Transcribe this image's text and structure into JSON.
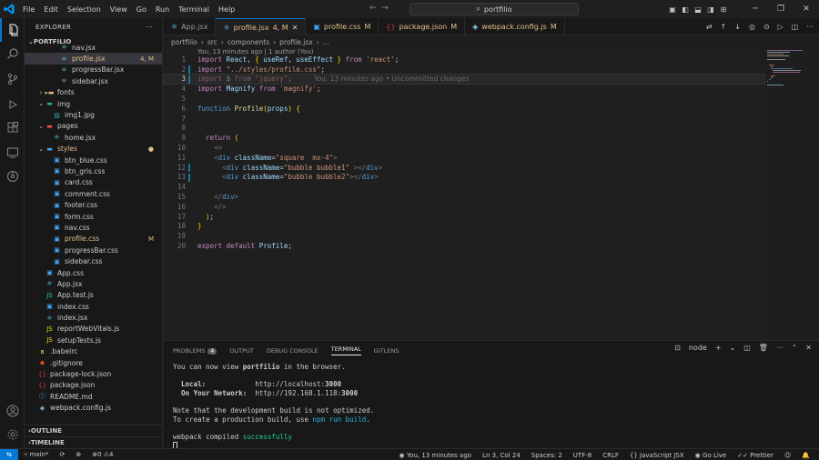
{
  "menu": [
    "File",
    "Edit",
    "Selection",
    "View",
    "Go",
    "Run",
    "Terminal",
    "Help"
  ],
  "command_center": "portfilio",
  "explorer": {
    "title": "EXPLORER",
    "root": "PORTFILIO",
    "rows": [
      {
        "name": "nav.jsx",
        "icon": "react",
        "depth": 3,
        "folder": false,
        "open": false,
        "badge": "",
        "sel": false
      },
      {
        "name": "profile.jsx",
        "icon": "react",
        "depth": 3,
        "folder": false,
        "open": false,
        "badge": "4, M",
        "sel": true
      },
      {
        "name": "progressBar.jsx",
        "icon": "react",
        "depth": 3,
        "folder": false,
        "open": false,
        "badge": "",
        "sel": false
      },
      {
        "name": "sidebar.jsx",
        "icon": "react",
        "depth": 3,
        "folder": false,
        "open": false,
        "badge": "",
        "sel": false
      },
      {
        "name": "fonts",
        "icon": "folder",
        "depth": 1,
        "folder": true,
        "open": false,
        "badge": "",
        "sel": false
      },
      {
        "name": "img",
        "icon": "folder-img",
        "depth": 1,
        "folder": true,
        "open": true,
        "badge": "",
        "sel": false
      },
      {
        "name": "img1.jpg",
        "icon": "image",
        "depth": 2,
        "folder": false,
        "open": false,
        "badge": "",
        "sel": false
      },
      {
        "name": "pages",
        "icon": "folder-pages",
        "depth": 1,
        "folder": true,
        "open": true,
        "badge": "",
        "sel": false
      },
      {
        "name": "home.jsx",
        "icon": "react",
        "depth": 2,
        "folder": false,
        "open": false,
        "badge": "",
        "sel": false
      },
      {
        "name": "styles",
        "icon": "folder-styles",
        "depth": 1,
        "folder": true,
        "open": true,
        "badge": "●",
        "sel": false
      },
      {
        "name": "btn_blue.css",
        "icon": "css",
        "depth": 2,
        "folder": false,
        "open": false,
        "badge": "",
        "sel": false
      },
      {
        "name": "btn_gris.css",
        "icon": "css",
        "depth": 2,
        "folder": false,
        "open": false,
        "badge": "",
        "sel": false
      },
      {
        "name": "card.css",
        "icon": "css",
        "depth": 2,
        "folder": false,
        "open": false,
        "badge": "",
        "sel": false
      },
      {
        "name": "comment.css",
        "icon": "css",
        "depth": 2,
        "folder": false,
        "open": false,
        "badge": "",
        "sel": false
      },
      {
        "name": "footer.css",
        "icon": "css",
        "depth": 2,
        "folder": false,
        "open": false,
        "badge": "",
        "sel": false
      },
      {
        "name": "form.css",
        "icon": "css",
        "depth": 2,
        "folder": false,
        "open": false,
        "badge": "",
        "sel": false
      },
      {
        "name": "nav.css",
        "icon": "css",
        "depth": 2,
        "folder": false,
        "open": false,
        "badge": "",
        "sel": false
      },
      {
        "name": "profile.css",
        "icon": "css",
        "depth": 2,
        "folder": false,
        "open": false,
        "badge": "M",
        "sel": false
      },
      {
        "name": "progressBar.css",
        "icon": "css",
        "depth": 2,
        "folder": false,
        "open": false,
        "badge": "",
        "sel": false
      },
      {
        "name": "sidebar.css",
        "icon": "css",
        "depth": 2,
        "folder": false,
        "open": false,
        "badge": "",
        "sel": false
      },
      {
        "name": "App.css",
        "icon": "css",
        "depth": 1,
        "folder": false,
        "open": false,
        "badge": "",
        "sel": false
      },
      {
        "name": "App.jsx",
        "icon": "react",
        "depth": 1,
        "folder": false,
        "open": false,
        "badge": "",
        "sel": false
      },
      {
        "name": "App.test.js",
        "icon": "test",
        "depth": 1,
        "folder": false,
        "open": false,
        "badge": "",
        "sel": false
      },
      {
        "name": "index.css",
        "icon": "css",
        "depth": 1,
        "folder": false,
        "open": false,
        "badge": "",
        "sel": false
      },
      {
        "name": "index.jsx",
        "icon": "react",
        "depth": 1,
        "folder": false,
        "open": false,
        "badge": "",
        "sel": false
      },
      {
        "name": "reportWebVitals.js",
        "icon": "js",
        "depth": 1,
        "folder": false,
        "open": false,
        "badge": "",
        "sel": false
      },
      {
        "name": "setupTests.js",
        "icon": "js",
        "depth": 1,
        "folder": false,
        "open": false,
        "badge": "",
        "sel": false
      },
      {
        "name": ".babelrc",
        "icon": "babel",
        "depth": 0,
        "folder": false,
        "open": false,
        "badge": "",
        "sel": false
      },
      {
        "name": ".gitignore",
        "icon": "git",
        "depth": 0,
        "folder": false,
        "open": false,
        "badge": "",
        "sel": false
      },
      {
        "name": "package-lock.json",
        "icon": "npm",
        "depth": 0,
        "folder": false,
        "open": false,
        "badge": "",
        "sel": false
      },
      {
        "name": "package.json",
        "icon": "npm",
        "depth": 0,
        "folder": false,
        "open": false,
        "badge": "",
        "sel": false
      },
      {
        "name": "README.md",
        "icon": "readme",
        "depth": 0,
        "folder": false,
        "open": false,
        "badge": "",
        "sel": false
      },
      {
        "name": "webpack.config.js",
        "icon": "webpack",
        "depth": 0,
        "folder": false,
        "open": false,
        "badge": "",
        "sel": false
      }
    ],
    "outline": "OUTLINE",
    "timeline": "TIMELINE"
  },
  "tabs": [
    {
      "name": "App.jsx",
      "icon": "react",
      "mod": "",
      "active": false
    },
    {
      "name": "profile.jsx",
      "icon": "react",
      "mod": "4, M",
      "active": true
    },
    {
      "name": "profile.css",
      "icon": "css",
      "mod": "M",
      "active": false
    },
    {
      "name": "package.json",
      "icon": "npm",
      "mod": "M",
      "active": false
    },
    {
      "name": "webpack.config.js",
      "icon": "webpack",
      "mod": "M",
      "active": false
    }
  ],
  "breadcrumb": [
    "portfilio",
    "src",
    "components",
    "profile.jsx",
    "..."
  ],
  "codelens": "You, 13 minutes ago | 1 author (You)",
  "code_lines": [
    "import React, { useRef, useEffect } from 'react';",
    "import \"../styles/profile.css\";",
    "import $ from \"jquery\";",
    "import Magnify from 'magnify';",
    "",
    "function Profile(props) {",
    "",
    "",
    "  return (",
    "    <>",
    "    <div className=\"square  mx-4\">",
    "      <div className=\"bubble bubble1\" ></div>",
    "      <div className=\"bubble bubble2\"></div>",
    "",
    "    </div>",
    "    </>",
    "  );",
    "}",
    "",
    "export default Profile;"
  ],
  "inline_blame": "You, 13 minutes ago • Uncommitted changes",
  "panel": {
    "tabs": [
      "PROBLEMS",
      "OUTPUT",
      "DEBUG CONSOLE",
      "TERMINAL",
      "GITLENS"
    ],
    "problems_count": "4",
    "active_tab": "TERMINAL",
    "shell": "node",
    "terminal": {
      "l1a": "You can now view ",
      "l1b": "portfilio",
      "l1c": " in the browser.",
      "local_label": "  Local:            ",
      "local_url_a": "http://localhost:",
      "local_port": "3000",
      "network_label": "  On Your Network:  ",
      "network_url_a": "http://192.168.1.118:",
      "network_port": "3000",
      "note1": "Note that the development build is not optimized.",
      "note2a": "To create a production build, use ",
      "note2b": "npm run build",
      "note2c": ".",
      "compiled_a": "webpack compiled ",
      "compiled_b": "successfully"
    }
  },
  "status": {
    "branch": "main*",
    "errors": "0",
    "warnings": "4",
    "blame": "You, 13 minutes ago",
    "position": "Ln 3, Col 24",
    "spaces": "Spaces: 2",
    "encoding": "UTF-8",
    "eol": "CRLF",
    "language": "JavaScript JSX",
    "golive": "Go Live",
    "prettier": "Prettier"
  },
  "colors": {
    "accent": "#0078d4",
    "modified": "#e2c08d",
    "react": "#61dafb",
    "css": "#42a5f5",
    "folder": "#dcb67a"
  }
}
